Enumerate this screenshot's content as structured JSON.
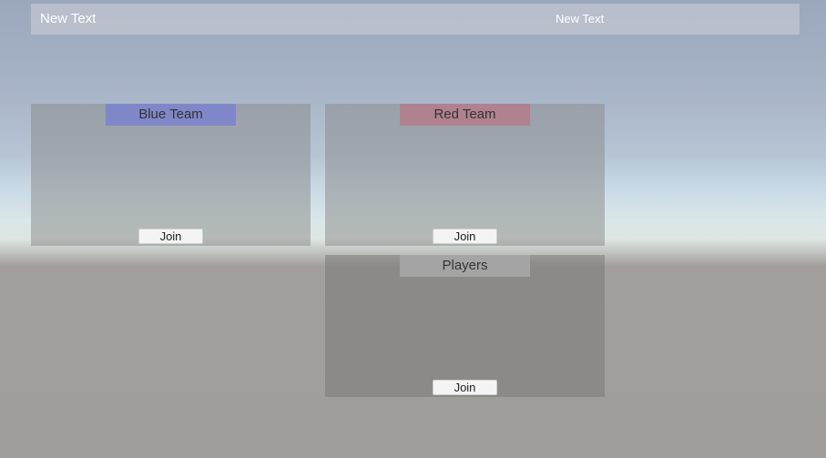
{
  "top_bar": {
    "left_text": "New Text",
    "right_text": "New Text"
  },
  "panels": {
    "blue_team": {
      "title": "Blue Team",
      "join_label": "Join",
      "header_color": "#8087c9"
    },
    "red_team": {
      "title": "Red Team",
      "join_label": "Join",
      "header_color": "#b08290"
    },
    "players": {
      "title": "Players",
      "join_label": "Join",
      "header_color": "#a4a4a4"
    }
  }
}
